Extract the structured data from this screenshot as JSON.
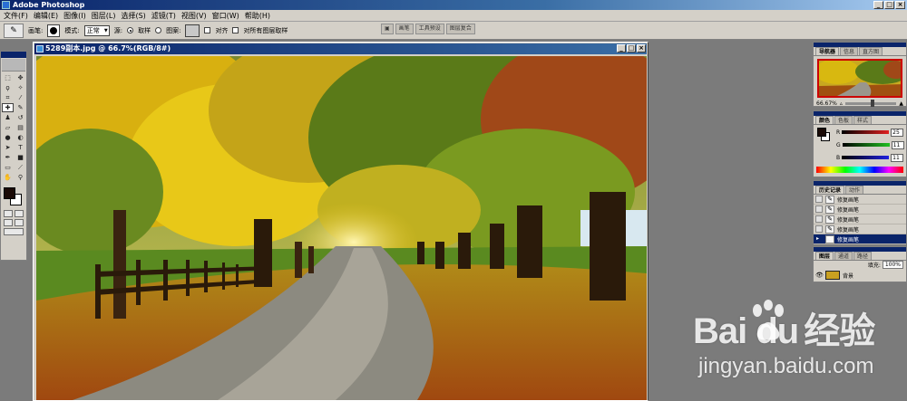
{
  "window": {
    "title": "Adobe Photoshop",
    "controls": [
      "_",
      "□",
      "×"
    ]
  },
  "menubar": {
    "items": [
      "文件(F)",
      "编辑(E)",
      "图像(I)",
      "图层(L)",
      "选择(S)",
      "滤镜(T)",
      "视图(V)",
      "窗口(W)",
      "帮助(H)"
    ]
  },
  "options": {
    "brush_label": "画笔:",
    "mode_label": "模式:",
    "mode_value": "正常",
    "source_label": "源:",
    "sampled_label": "取样",
    "pattern_label": "图案:",
    "aligned_label": "对齐",
    "all_layers_label": "对所有图层取样"
  },
  "palette_well": {
    "tabs": [
      "画笔",
      "工具预设",
      "图层复合"
    ]
  },
  "document": {
    "title": "5289副本.jpg @ 66.7%(RGB/8#)",
    "status": "66.67%"
  },
  "navigator": {
    "tabs": [
      "导航器",
      "信息",
      "直方图"
    ],
    "zoom": "66.67%"
  },
  "color_panel": {
    "tabs": [
      "颜色",
      "色板",
      "样式"
    ],
    "channels": [
      {
        "label": "R",
        "value": "25",
        "color": "#e03030"
      },
      {
        "label": "G",
        "value": "11",
        "color": "#30b030"
      },
      {
        "label": "B",
        "value": "11",
        "color": "#3030d0"
      }
    ],
    "foreground": "#1a0a06"
  },
  "history": {
    "tabs": [
      "历史记录",
      "动作"
    ],
    "items": [
      {
        "label": "修复画笔",
        "active": false
      },
      {
        "label": "修复画笔",
        "active": false
      },
      {
        "label": "修复画笔",
        "active": false
      },
      {
        "label": "修复画笔",
        "active": false
      },
      {
        "label": "修复画笔",
        "active": true
      }
    ]
  },
  "layers": {
    "tabs": [
      "图层",
      "通道",
      "路径"
    ],
    "fill_label": "填充:",
    "fill_value": "100%",
    "items": [
      {
        "name": "背景",
        "active": true
      }
    ]
  },
  "watermark": {
    "logo": "Bai  du",
    "logo_cn": "经验",
    "url": "jingyan.baidu.com"
  }
}
